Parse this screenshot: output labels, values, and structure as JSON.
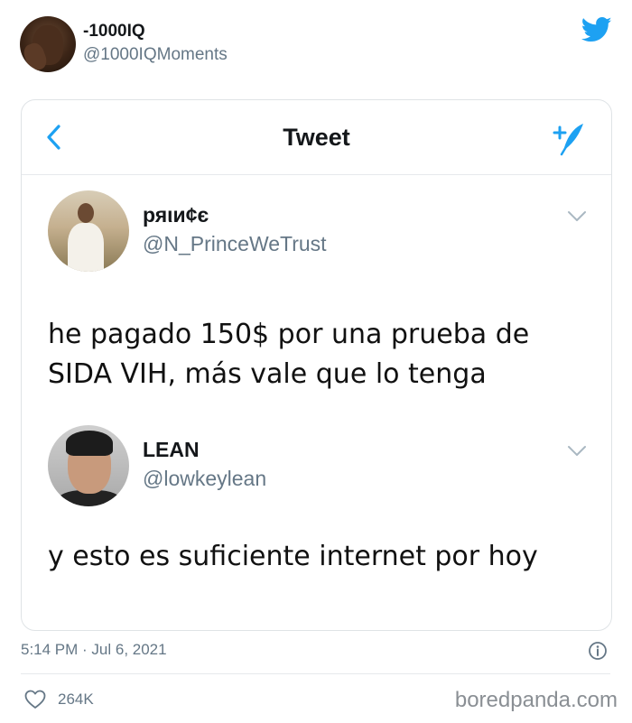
{
  "header": {
    "display_name": "-1000IQ",
    "handle": "@1000IQMoments"
  },
  "card": {
    "title": "Tweet",
    "posts": [
      {
        "name": "ряιи¢є",
        "handle": "@N_PrinceWeTrust",
        "text": "he pagado 150$ por una prueba de SIDA VIH, más vale que lo tenga"
      },
      {
        "name": "LEAN",
        "handle": "@lowkeylean",
        "text": "y esto es suficiente internet por hoy"
      }
    ]
  },
  "footer": {
    "timestamp": "5:14 PM · Jul 6, 2021",
    "likes": "264K",
    "watermark": "boredpanda.com"
  },
  "colors": {
    "accent": "#1da1f2",
    "secondary_text": "#657786",
    "border": "#dfe3e6"
  },
  "icons": [
    "twitter-bird-icon",
    "back-chevron-icon",
    "compose-tweet-icon",
    "chevron-down-icon",
    "info-icon",
    "heart-icon"
  ]
}
